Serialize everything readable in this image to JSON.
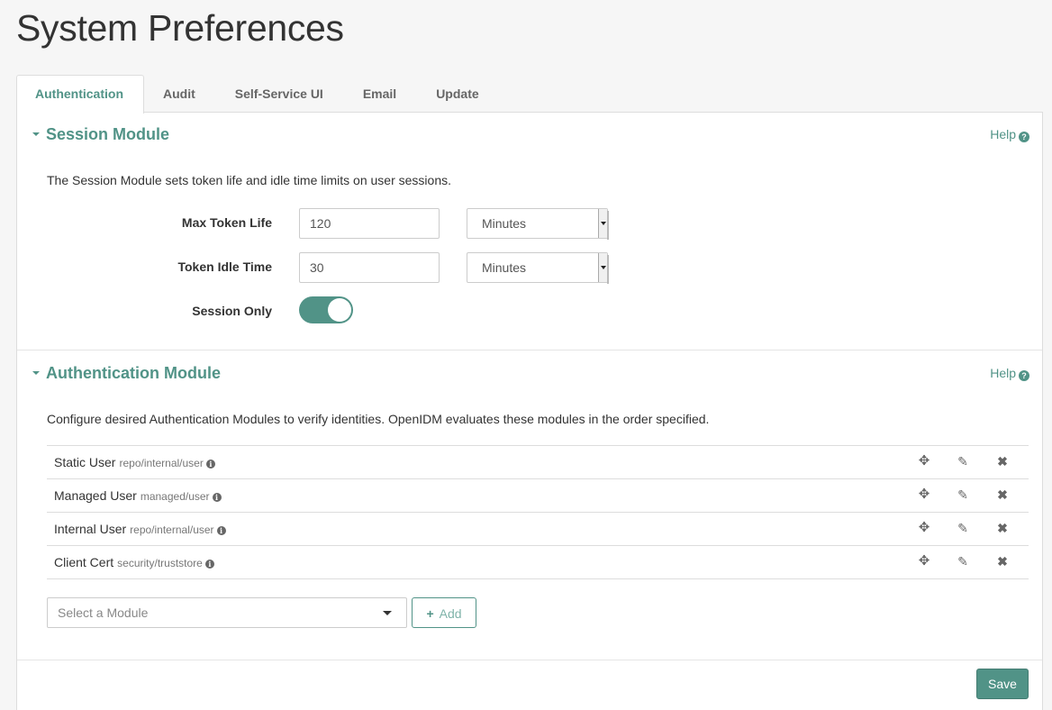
{
  "page": {
    "title": "System Preferences"
  },
  "tabs": [
    {
      "label": "Authentication",
      "active": true
    },
    {
      "label": "Audit"
    },
    {
      "label": "Self-Service UI"
    },
    {
      "label": "Email"
    },
    {
      "label": "Update"
    }
  ],
  "session": {
    "title": "Session Module",
    "help": "Help",
    "description": "The Session Module sets token life and idle time limits on user sessions.",
    "max_token_label": "Max Token Life",
    "max_token_value": "120",
    "max_token_unit": "Minutes",
    "idle_label": "Token Idle Time",
    "idle_value": "30",
    "idle_unit": "Minutes",
    "session_only_label": "Session Only",
    "session_only_on": true
  },
  "auth": {
    "title": "Authentication Module",
    "help": "Help",
    "description": "Configure desired Authentication Modules to verify identities. OpenIDM evaluates these modules in the order specified.",
    "modules": [
      {
        "name": "Static User",
        "path": "repo/internal/user"
      },
      {
        "name": "Managed User",
        "path": "managed/user"
      },
      {
        "name": "Internal User",
        "path": "repo/internal/user"
      },
      {
        "name": "Client Cert",
        "path": "security/truststore"
      }
    ],
    "select_placeholder": "Select a Module",
    "add_label": "Add"
  },
  "footer": {
    "save_label": "Save"
  },
  "colors": {
    "accent": "#519387"
  },
  "icons": {
    "help": "question-circle-icon",
    "info": "info-circle-icon",
    "move": "move-arrows-icon",
    "edit": "pencil-icon",
    "delete": "times-icon"
  }
}
